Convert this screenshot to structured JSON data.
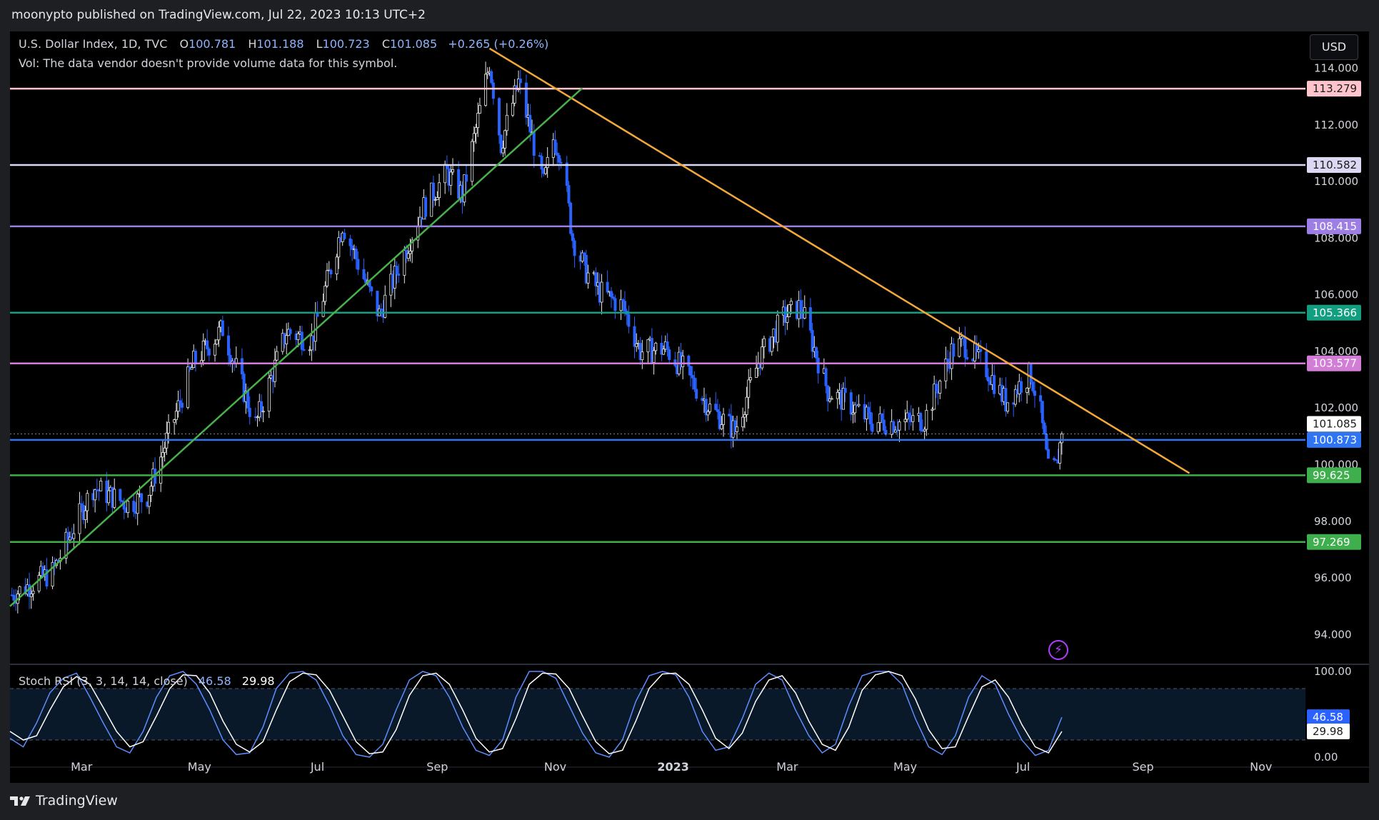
{
  "header": {
    "published_by": "moonypto published on TradingView.com, Jul 22, 2023 10:13 UTC+2",
    "symbol": "U.S. Dollar Index, 1D, TVC",
    "open_label": "O",
    "open": "100.781",
    "high_label": "H",
    "high": "101.188",
    "low_label": "L",
    "low": "100.723",
    "close_label": "C",
    "close": "101.085",
    "change": "+0.265 (+0.26%)",
    "volume_note": "Vol: The data vendor doesn't provide volume data for this symbol.",
    "currency": "USD"
  },
  "brand": "TradingView",
  "chart_data": [
    {
      "type": "candlestick",
      "title": "U.S. Dollar Index, 1D, TVC",
      "ylim": [
        93,
        115.3
      ],
      "y_ticks": [
        "94.000",
        "96.000",
        "98.000",
        "100.000",
        "102.000",
        "104.000",
        "106.000",
        "108.000",
        "110.000",
        "112.000",
        "114.000"
      ],
      "x_ticks": [
        "Mar",
        "May",
        "Jul",
        "Sep",
        "Nov",
        "2023",
        "Mar",
        "May",
        "Jul",
        "Sep",
        "Nov"
      ],
      "x_range": [
        "2022-01-23",
        "2023-11-24"
      ],
      "price_path": [
        [
          "2022-01-24",
          95.4
        ],
        [
          "2022-02-14",
          96.2
        ],
        [
          "2022-03-07",
          99.2
        ],
        [
          "2022-03-25",
          98.6
        ],
        [
          "2022-04-04",
          98.9
        ],
        [
          "2022-04-28",
          103.6
        ],
        [
          "2022-05-13",
          104.8
        ],
        [
          "2022-05-30",
          101.4
        ],
        [
          "2022-06-15",
          104.7
        ],
        [
          "2022-06-28",
          104.4
        ],
        [
          "2022-07-14",
          108.5
        ],
        [
          "2022-07-29",
          105.9
        ],
        [
          "2022-08-02",
          105.3
        ],
        [
          "2022-08-24",
          109.0
        ],
        [
          "2022-09-06",
          110.3
        ],
        [
          "2022-09-14",
          109.5
        ],
        [
          "2022-09-28",
          114.2
        ],
        [
          "2022-10-04",
          111.3
        ],
        [
          "2022-10-13",
          113.5
        ],
        [
          "2022-10-26",
          109.9
        ],
        [
          "2022-10-31",
          111.5
        ],
        [
          "2022-11-04",
          111.0
        ],
        [
          "2022-11-10",
          108.0
        ],
        [
          "2022-11-17",
          106.8
        ],
        [
          "2022-11-24",
          106.1
        ],
        [
          "2022-12-06",
          105.6
        ],
        [
          "2022-12-15",
          104.0
        ],
        [
          "2022-12-28",
          104.1
        ],
        [
          "2023-01-06",
          103.4
        ],
        [
          "2023-01-20",
          102.0
        ],
        [
          "2023-02-02",
          101.2
        ],
        [
          "2023-02-15",
          103.8
        ],
        [
          "2023-02-27",
          105.2
        ],
        [
          "2023-03-08",
          105.6
        ],
        [
          "2023-03-22",
          102.6
        ],
        [
          "2023-04-03",
          102.1
        ],
        [
          "2023-04-14",
          101.5
        ],
        [
          "2023-04-28",
          101.5
        ],
        [
          "2023-05-11",
          101.6
        ],
        [
          "2023-05-25",
          104.0
        ],
        [
          "2023-05-31",
          104.3
        ],
        [
          "2023-06-13",
          103.3
        ],
        [
          "2023-06-22",
          102.2
        ],
        [
          "2023-06-30",
          102.9
        ],
        [
          "2023-07-05",
          103.2
        ],
        [
          "2023-07-10",
          101.8
        ],
        [
          "2023-07-14",
          99.8
        ],
        [
          "2023-07-18",
          99.9
        ],
        [
          "2023-07-21",
          101.1
        ]
      ],
      "horizontal_levels": [
        {
          "value": 113.279,
          "label": "113.279",
          "color": "#ffc4cc",
          "text_color": "#1a1a1a"
        },
        {
          "value": 110.582,
          "label": "110.582",
          "color": "#dcd8f4",
          "text_color": "#1a1a1a"
        },
        {
          "value": 108.415,
          "label": "108.415",
          "color": "#9c7ee4",
          "text_color": "#ffffff"
        },
        {
          "value": 105.366,
          "label": "105.366",
          "color": "#129e80",
          "text_color": "#ffffff"
        },
        {
          "value": 103.577,
          "label": "103.577",
          "color": "#d37ed6",
          "text_color": "#ffffff"
        },
        {
          "value": 100.873,
          "label": "100.873",
          "color": "#2f74f2",
          "text_color": "#ffffff"
        },
        {
          "value": 99.625,
          "label": "99.625",
          "color": "#3fae4c",
          "text_color": "#ffffff"
        },
        {
          "value": 97.269,
          "label": "97.269",
          "color": "#3fae4c",
          "text_color": "#ffffff"
        }
      ],
      "current_price": {
        "value": 101.085,
        "label": "101.085"
      },
      "trendlines": [
        {
          "color": "#f5a83a",
          "from": [
            "2022-09-28",
            114.7
          ],
          "to": [
            "2023-09-25",
            99.7
          ]
        },
        {
          "color": "#47b14a",
          "from": [
            "2022-01-23",
            95.0
          ],
          "to": [
            "2022-11-15",
            113.3
          ]
        }
      ],
      "candle_colors": {
        "up": "#e6e6e6",
        "down": "#2962ff"
      }
    },
    {
      "type": "line",
      "title": "Stoch RSI (3, 3, 14, 14, close)",
      "ylim": [
        0,
        100
      ],
      "y_ticks": [
        "100.00",
        "0.00"
      ],
      "bands": [
        80,
        20
      ],
      "series": [
        {
          "name": "K",
          "current": "46.58",
          "color": "#5b8dff",
          "values": [
            22,
            12,
            40,
            75,
            92,
            98,
            70,
            40,
            12,
            5,
            30,
            70,
            95,
            100,
            85,
            55,
            20,
            3,
            5,
            35,
            80,
            98,
            100,
            90,
            60,
            25,
            3,
            0,
            15,
            55,
            90,
            100,
            95,
            70,
            35,
            8,
            2,
            20,
            70,
            100,
            100,
            92,
            60,
            28,
            5,
            0,
            20,
            65,
            95,
            100,
            96,
            70,
            30,
            8,
            12,
            45,
            85,
            98,
            90,
            55,
            25,
            5,
            15,
            60,
            95,
            100,
            100,
            85,
            45,
            12,
            3,
            25,
            70,
            95,
            85,
            50,
            20,
            2,
            8,
            46.58
          ]
        },
        {
          "name": "D",
          "current": "29.98",
          "color": "#ffffff",
          "values": [
            30,
            20,
            25,
            55,
            82,
            94,
            85,
            58,
            30,
            12,
            18,
            48,
            80,
            96,
            95,
            75,
            42,
            15,
            6,
            18,
            55,
            88,
            98,
            96,
            78,
            48,
            18,
            4,
            6,
            32,
            72,
            95,
            98,
            85,
            55,
            22,
            6,
            10,
            45,
            85,
            98,
            97,
            80,
            48,
            18,
            4,
            8,
            42,
            80,
            97,
            98,
            85,
            55,
            22,
            10,
            28,
            65,
            90,
            95,
            75,
            42,
            15,
            8,
            35,
            78,
            96,
            100,
            95,
            68,
            32,
            10,
            12,
            48,
            82,
            90,
            70,
            38,
            12,
            5,
            29.98
          ]
        }
      ]
    }
  ]
}
